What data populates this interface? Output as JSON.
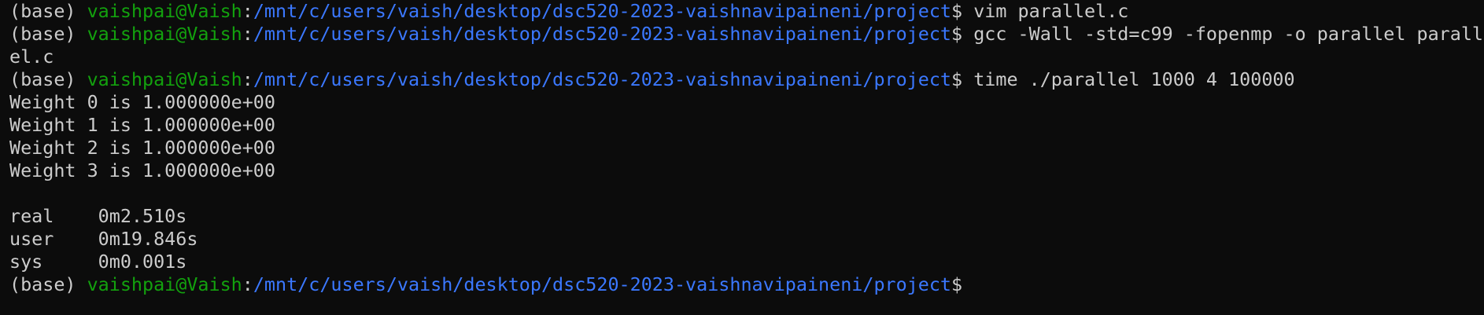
{
  "prompt": {
    "env": "(base) ",
    "userhost": "vaishpai@Vaish",
    "sep": ":",
    "path": "/mnt/c/users/vaish/desktop/dsc520-2023-vaishnavipaineni/project",
    "dollar": "$"
  },
  "colors": {
    "background": "#0c0c0c",
    "text": "#cccccc",
    "userhost": "#13a10e",
    "path": "#3b78ff"
  },
  "lines": [
    {
      "type": "prompt",
      "cmd": " vim parallel.c"
    },
    {
      "type": "prompt",
      "cmd": " gcc -Wall -std=c99 -fopenmp -o parallel parall"
    },
    {
      "type": "output",
      "text": "el.c"
    },
    {
      "type": "prompt",
      "cmd": " time ./parallel 1000 4 100000"
    },
    {
      "type": "output",
      "text": "Weight 0 is 1.000000e+00"
    },
    {
      "type": "output",
      "text": "Weight 1 is 1.000000e+00"
    },
    {
      "type": "output",
      "text": "Weight 2 is 1.000000e+00"
    },
    {
      "type": "output",
      "text": "Weight 3 is 1.000000e+00"
    },
    {
      "type": "output",
      "text": ""
    },
    {
      "type": "output",
      "text": "real    0m2.510s"
    },
    {
      "type": "output",
      "text": "user    0m19.846s"
    },
    {
      "type": "output",
      "text": "sys     0m0.001s"
    },
    {
      "type": "prompt",
      "cmd": ""
    }
  ]
}
